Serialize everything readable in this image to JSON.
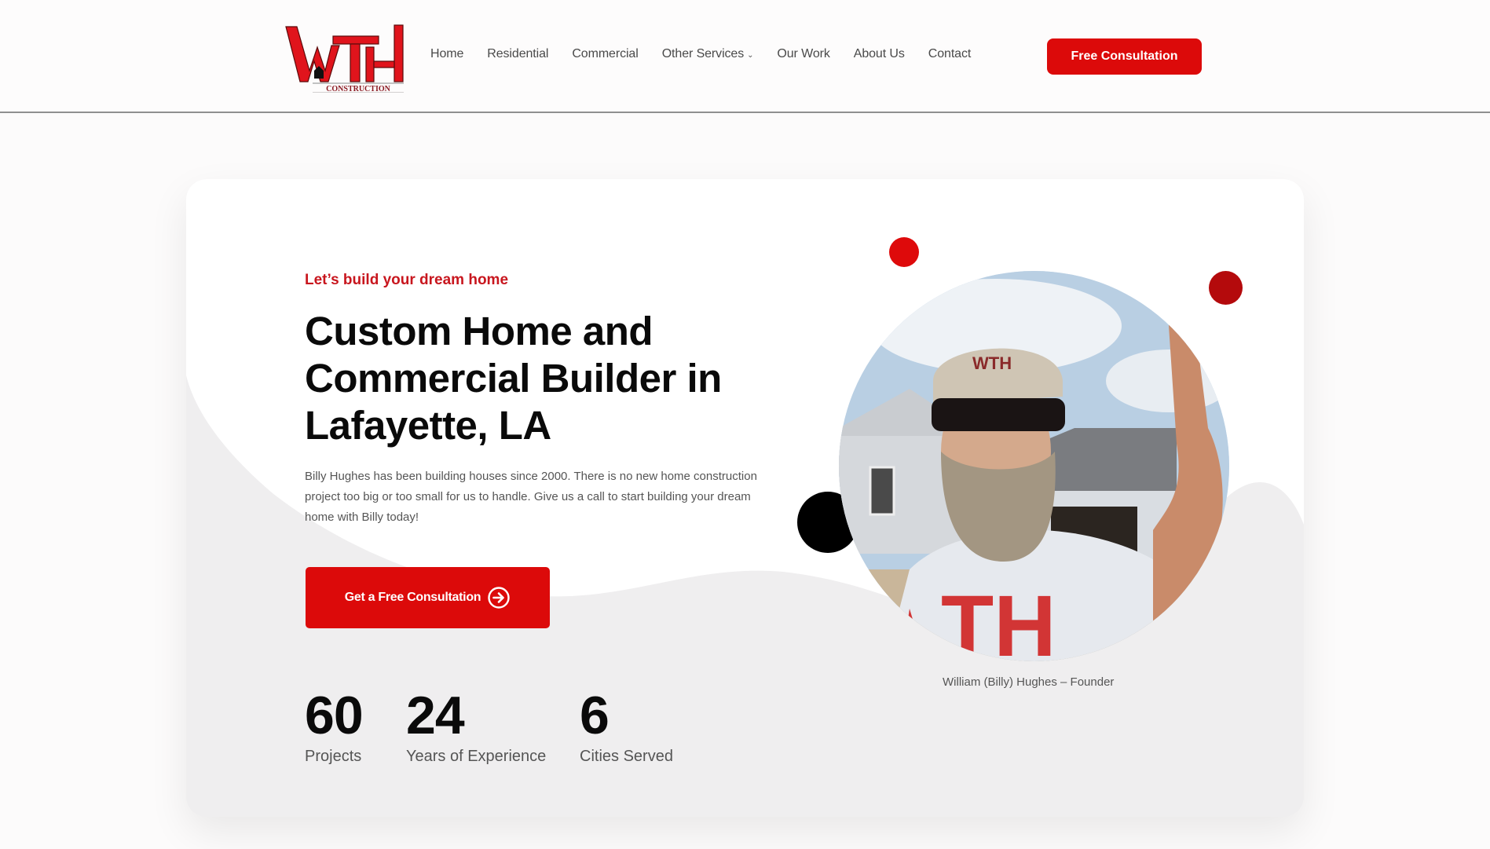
{
  "header": {
    "logo": {
      "text_main": "WTH",
      "text_sub": "CONSTRUCTION",
      "icon": "house-icon"
    },
    "nav": [
      {
        "label": "Home"
      },
      {
        "label": "Residential"
      },
      {
        "label": "Commercial"
      },
      {
        "label": "Other Services",
        "has_dropdown": true
      },
      {
        "label": "Our Work"
      },
      {
        "label": "About Us"
      },
      {
        "label": "Contact"
      }
    ],
    "cta_label": "Free Consultation"
  },
  "hero": {
    "eyebrow": "Let’s build your dream home",
    "headline_lines": [
      "Custom Home and",
      "Commercial Builder in",
      "Lafayette, LA"
    ],
    "description": "Billy Hughes has been building houses since 2000. There is no new home construction project too big or too small for us to handle. Give us a call to start building your dream home with Billy today!",
    "cta_label": "Get a Free Consultation",
    "cta_icon": "arrow-circle-right-icon",
    "stats": [
      {
        "value": "60",
        "label": "Projects"
      },
      {
        "value": "24",
        "label": "Years of Experience"
      },
      {
        "value": "6",
        "label": "Cities Served"
      }
    ],
    "photo_alt": "Photo of William (Billy) Hughes at a construction site wearing a WTH cap and shirt",
    "photo_caption": "William (Billy) Hughes – Founder"
  },
  "colors": {
    "accent": "#dc0a0a",
    "accent_dark": "#b40a0c",
    "eyebrow": "#c8161e",
    "text_dark": "#0a0a0a",
    "text_muted": "#555555",
    "card_bg": "#efeeef"
  }
}
